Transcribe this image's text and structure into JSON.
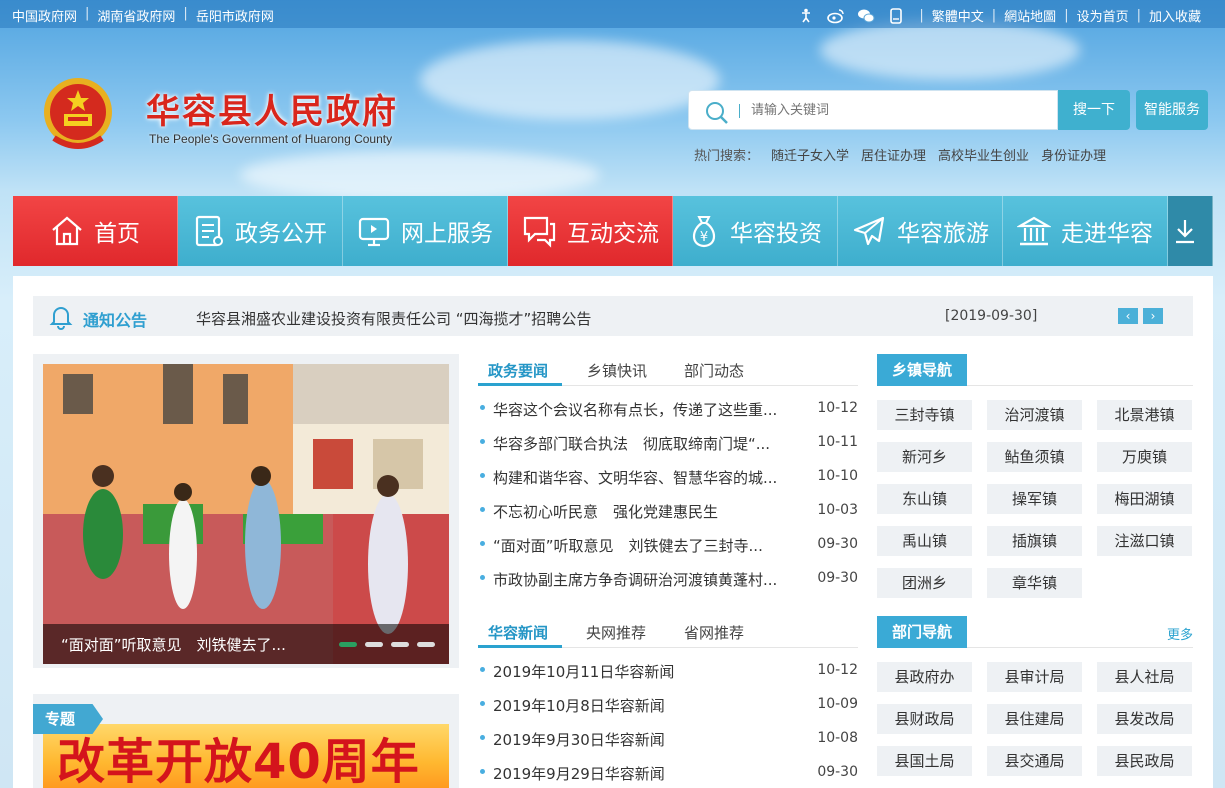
{
  "topbar": {
    "left_links": [
      "中国政府网",
      "湖南省政府网",
      "岳阳市政府网"
    ],
    "right_links": [
      "繁體中文",
      "網站地圖",
      "设为首页",
      "加入收藏"
    ],
    "icons": [
      "accessibility-icon",
      "weibo-icon",
      "wechat-icon",
      "mobile-icon"
    ]
  },
  "header": {
    "title": "华容县人民政府",
    "subtitle": "The People's Government of Huarong County"
  },
  "search": {
    "placeholder": "请输入关键词",
    "button": "搜一下",
    "smart_service": "智能服务",
    "hot_label": "热门搜索：",
    "hot_terms": [
      "随迁子女入学",
      "居住证办理",
      "高校毕业生创业",
      "身份证办理"
    ]
  },
  "nav": {
    "items": [
      {
        "label": "首页",
        "icon": "home-icon"
      },
      {
        "label": "政务公开",
        "icon": "document-icon"
      },
      {
        "label": "网上服务",
        "icon": "monitor-icon"
      },
      {
        "label": "互动交流",
        "icon": "chat-icon"
      },
      {
        "label": "华容投资",
        "icon": "money-bag-icon"
      },
      {
        "label": "华容旅游",
        "icon": "plane-icon"
      },
      {
        "label": "走进华容",
        "icon": "building-icon"
      }
    ],
    "more_icon": "download-arrow-icon"
  },
  "notice": {
    "label": "通知公告",
    "text": "华容县湘盛农业建设投资有限责任公司 “四海揽才”招聘公告",
    "date": "[2019-09-30]"
  },
  "slider": {
    "caption": "“面对面”听取意见　刘铁健去了..."
  },
  "special": {
    "tag": "专题",
    "banner_text": "改革开放40周年"
  },
  "news1": {
    "tabs": [
      "政务要闻",
      "乡镇快讯",
      "部门动态"
    ],
    "items": [
      {
        "title": "华容这个会议名称有点长，传递了这些重...",
        "date": "10-12"
      },
      {
        "title": "华容多部门联合执法　彻底取缔南门堤“...",
        "date": "10-11"
      },
      {
        "title": "构建和谐华容、文明华容、智慧华容的城...",
        "date": "10-10"
      },
      {
        "title": "不忘初心听民意　强化党建惠民生",
        "date": "10-03"
      },
      {
        "title": "“面对面”听取意见　刘铁健去了三封寺...",
        "date": "09-30"
      },
      {
        "title": "市政协副主席方争奇调研治河渡镇黄蓬村...",
        "date": "09-30"
      }
    ]
  },
  "news2": {
    "tabs": [
      "华容新闻",
      "央网推荐",
      "省网推荐"
    ],
    "items": [
      {
        "title": "2019年10月11日华容新闻",
        "date": "10-12"
      },
      {
        "title": "2019年10月8日华容新闻",
        "date": "10-09"
      },
      {
        "title": "2019年9月30日华容新闻",
        "date": "10-08"
      },
      {
        "title": "2019年9月29日华容新闻",
        "date": "09-30"
      }
    ]
  },
  "towns": {
    "title": "乡镇导航",
    "items": [
      "三封寺镇",
      "治河渡镇",
      "北景港镇",
      "新河乡",
      "鲇鱼须镇",
      "万庾镇",
      "东山镇",
      "操军镇",
      "梅田湖镇",
      "禹山镇",
      "插旗镇",
      "注滋口镇",
      "团洲乡",
      "章华镇"
    ]
  },
  "depts": {
    "title": "部门导航",
    "more": "更多",
    "items": [
      "县政府办",
      "县审计局",
      "县人社局",
      "县财政局",
      "县住建局",
      "县发改局",
      "县国土局",
      "县交通局",
      "县民政局"
    ]
  },
  "colors": {
    "nav_red": "#e0282c",
    "nav_teal": "#3eaecd",
    "accent": "#2aa2cf",
    "title_red": "#d9261c"
  }
}
